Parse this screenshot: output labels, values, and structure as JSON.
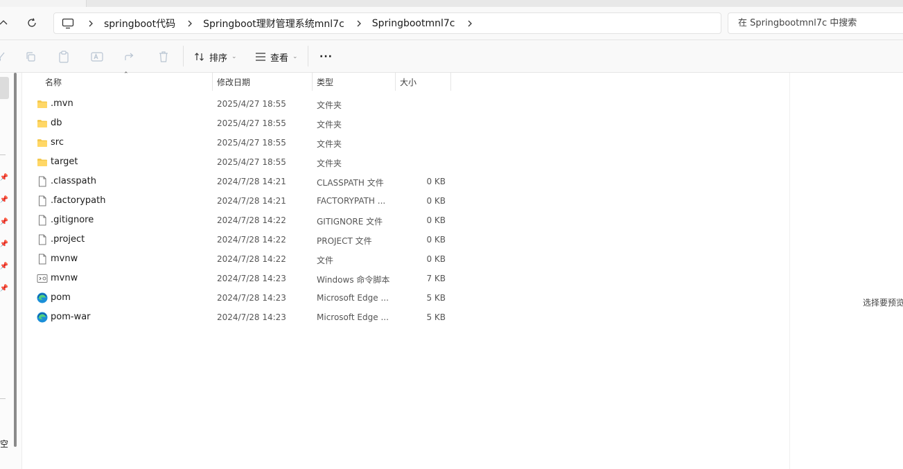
{
  "breadcrumb": {
    "items": [
      "springboot代码",
      "Springboot理财管理系统mnl7c",
      "Springbootmnl7c"
    ]
  },
  "search": {
    "placeholder": "在 Springbootmnl7c 中搜索"
  },
  "toolbar": {
    "sort_label": "排序",
    "view_label": "查看",
    "more_label": "···"
  },
  "columns": {
    "name": "名称",
    "date": "修改日期",
    "type": "类型",
    "size": "大小"
  },
  "files": [
    {
      "name": ".mvn",
      "date": "2025/4/27 18:55",
      "type": "文件夹",
      "size": "",
      "icon": "folder-icon"
    },
    {
      "name": "db",
      "date": "2025/4/27 18:55",
      "type": "文件夹",
      "size": "",
      "icon": "folder-icon"
    },
    {
      "name": "src",
      "date": "2025/4/27 18:55",
      "type": "文件夹",
      "size": "",
      "icon": "folder-icon"
    },
    {
      "name": "target",
      "date": "2025/4/27 18:55",
      "type": "文件夹",
      "size": "",
      "icon": "folder-icon"
    },
    {
      "name": ".classpath",
      "date": "2024/7/28 14:21",
      "type": "CLASSPATH 文件",
      "size": "0 KB",
      "icon": "file-icon"
    },
    {
      "name": ".factorypath",
      "date": "2024/7/28 14:21",
      "type": "FACTORYPATH ...",
      "size": "0 KB",
      "icon": "file-icon"
    },
    {
      "name": ".gitignore",
      "date": "2024/7/28 14:22",
      "type": "GITIGNORE 文件",
      "size": "0 KB",
      "icon": "file-icon"
    },
    {
      "name": ".project",
      "date": "2024/7/28 14:22",
      "type": "PROJECT 文件",
      "size": "0 KB",
      "icon": "file-icon"
    },
    {
      "name": "mvnw",
      "date": "2024/7/28 14:22",
      "type": "文件",
      "size": "0 KB",
      "icon": "file-icon"
    },
    {
      "name": "mvnw",
      "date": "2024/7/28 14:23",
      "type": "Windows 命令脚本",
      "size": "7 KB",
      "icon": "script-icon"
    },
    {
      "name": "pom",
      "date": "2024/7/28 14:23",
      "type": "Microsoft Edge ...",
      "size": "5 KB",
      "icon": "edge-icon"
    },
    {
      "name": "pom-war",
      "date": "2024/7/28 14:23",
      "type": "Microsoft Edge ...",
      "size": "5 KB",
      "icon": "edge-icon"
    }
  ],
  "preview": {
    "text": "选择要预览"
  },
  "left_pane": {
    "fragment": "空"
  }
}
